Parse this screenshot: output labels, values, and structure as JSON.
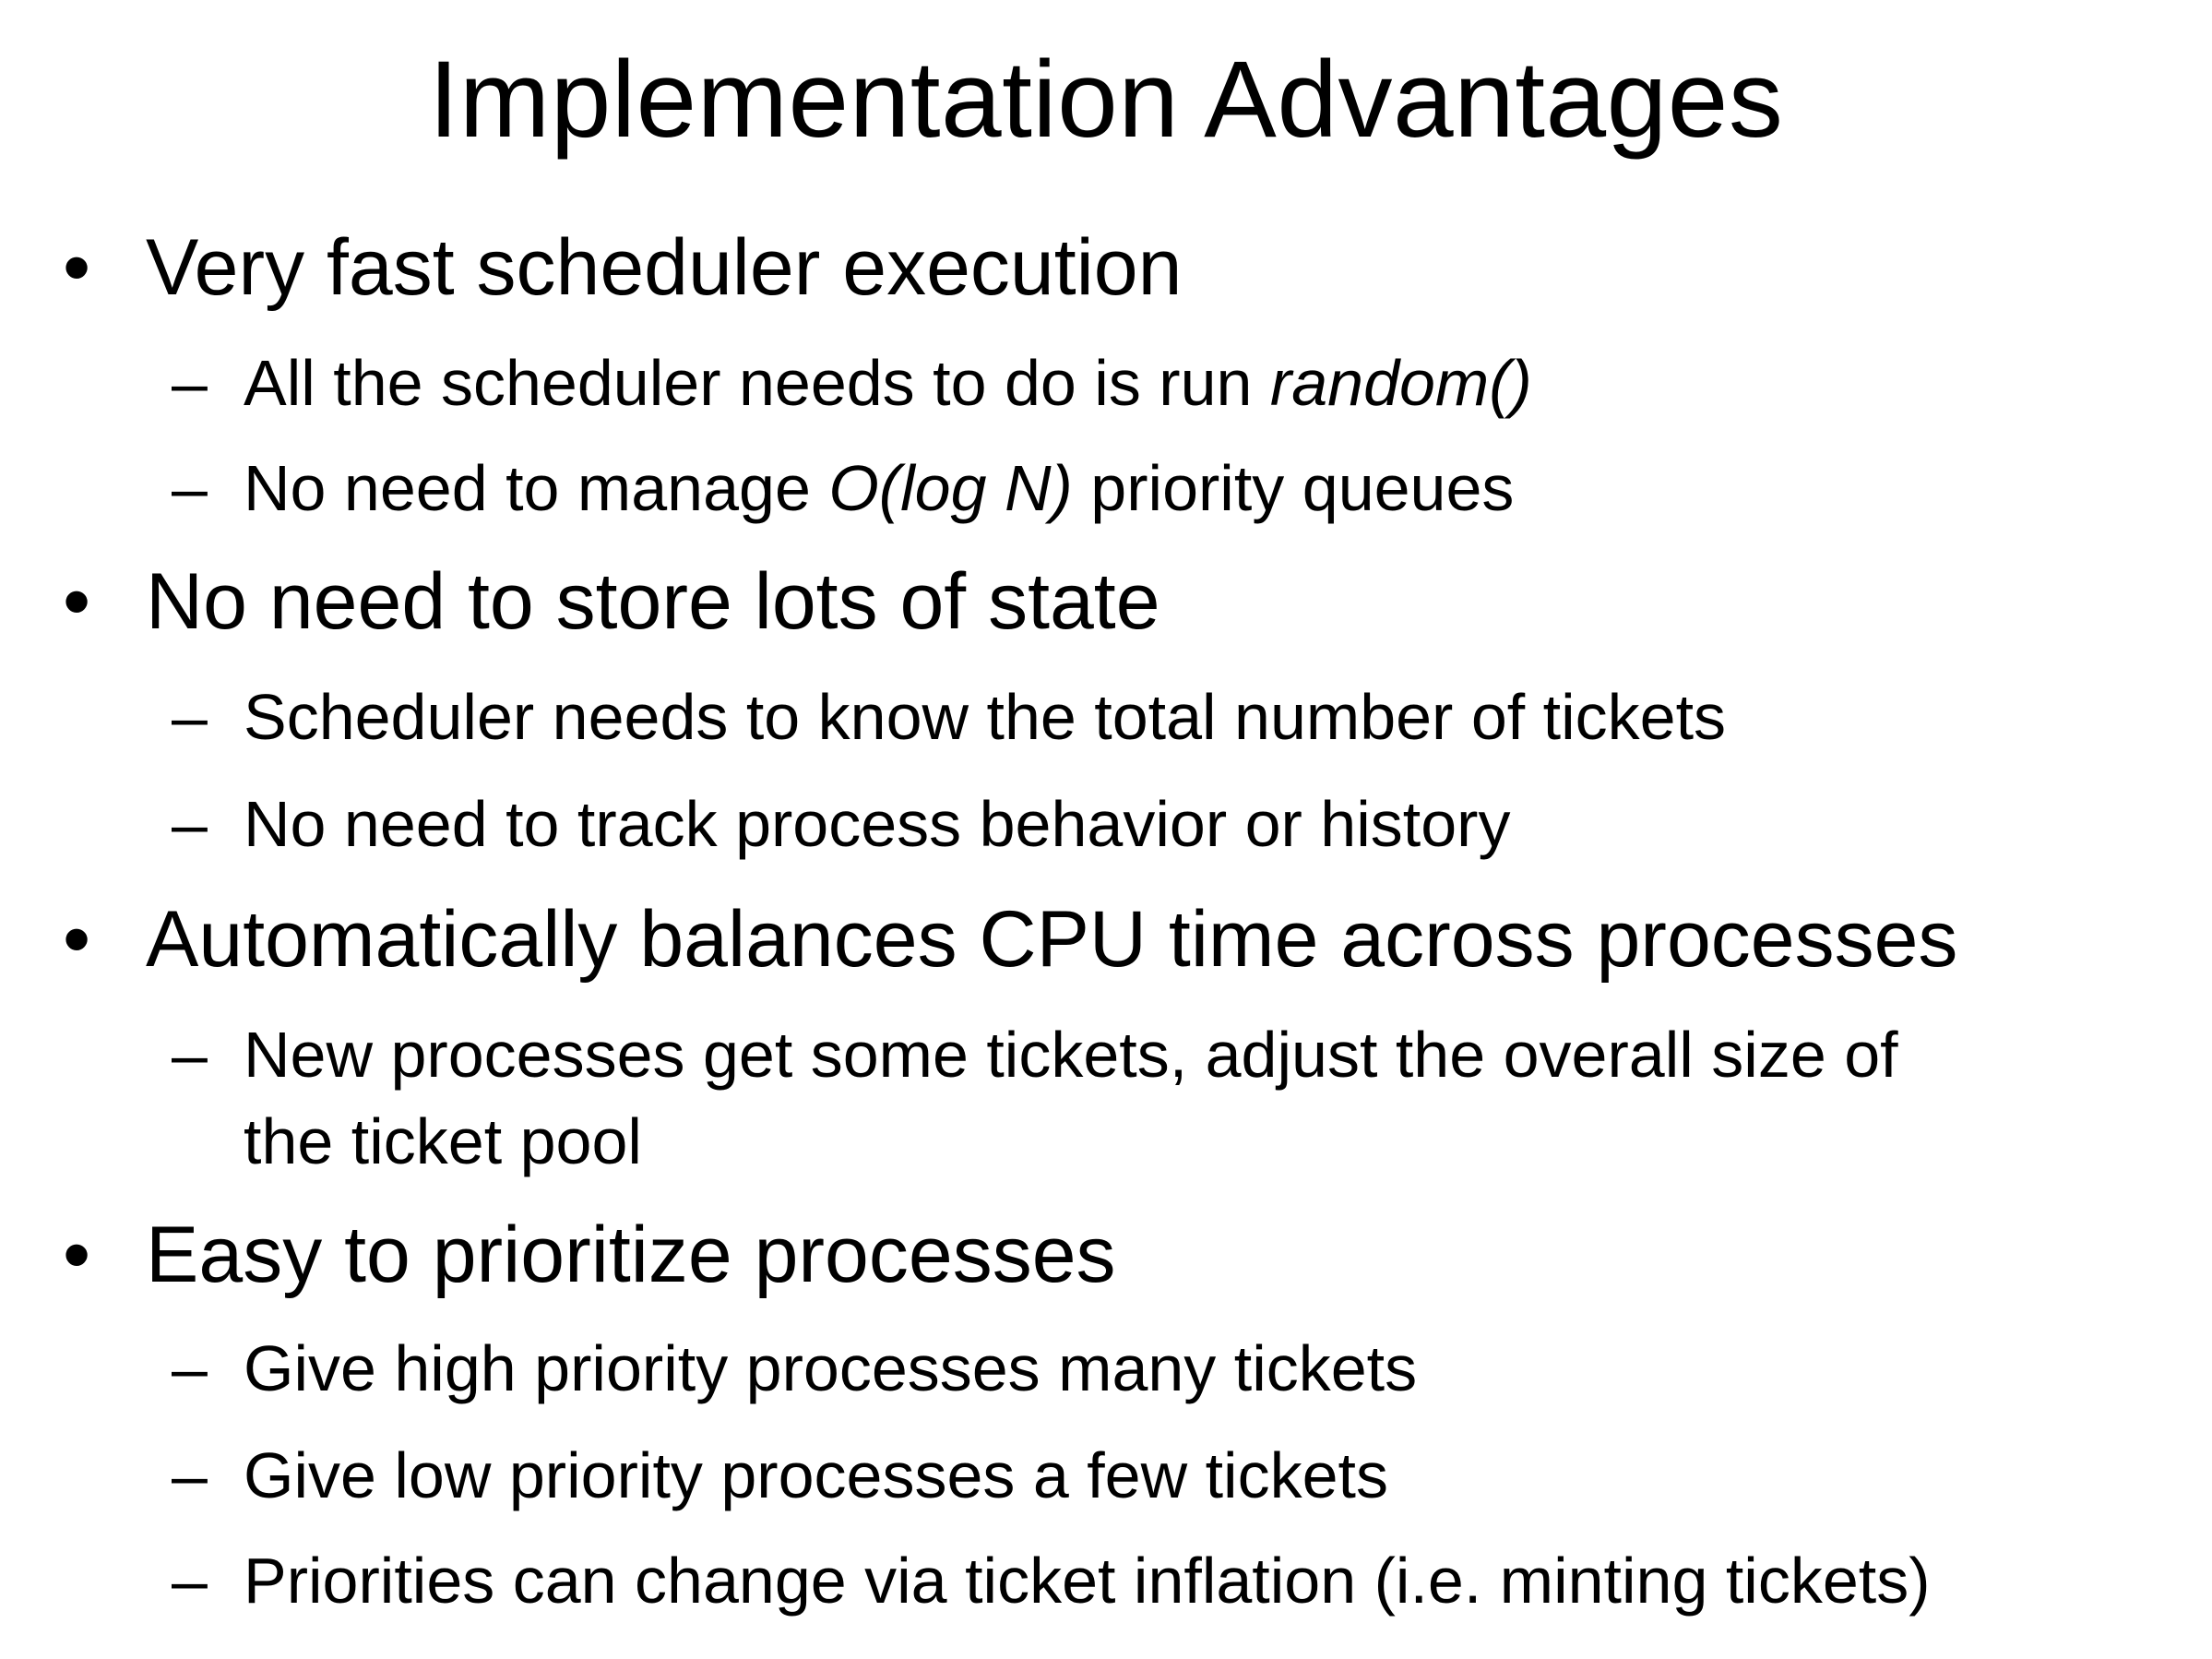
{
  "slide": {
    "title": "Implementation Advantages",
    "bullet_glyph": "•",
    "dash_glyph": "–",
    "items": [
      {
        "text": "Very fast scheduler execution",
        "subs": [
          {
            "before": "All the scheduler needs to do is run ",
            "italic": "random()",
            "after": ""
          },
          {
            "before": "No need to manage ",
            "italic": "O(log N)",
            "after": " priority queues"
          }
        ]
      },
      {
        "text": "No need to store lots of state",
        "subs": [
          {
            "text": "Scheduler needs to know the total number of tickets"
          },
          {
            "text": "No need to track process behavior or history"
          }
        ]
      },
      {
        "text": "Automatically balances CPU time across processes",
        "subs": [
          {
            "line1": "New processes get some tickets, adjust the overall size of",
            "line2": "the ticket pool"
          }
        ]
      },
      {
        "text": "Easy to prioritize processes",
        "subs": [
          {
            "text": "Give high priority processes many tickets"
          },
          {
            "text": "Give low priority processes a few tickets"
          },
          {
            "text": "Priorities can change via ticket inflation (i.e. minting tickets)"
          }
        ]
      }
    ]
  }
}
